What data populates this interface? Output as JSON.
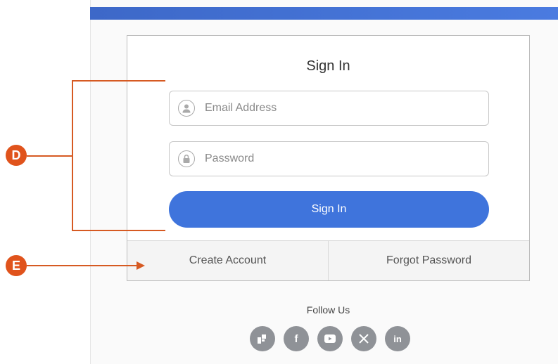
{
  "form": {
    "title": "Sign In",
    "email_placeholder": "Email Address",
    "password_placeholder": "Password",
    "submit_label": "Sign In"
  },
  "footer_links": {
    "create_account": "Create Account",
    "forgot_password": "Forgot Password"
  },
  "follow": {
    "label": "Follow Us",
    "icons": [
      "brand-icon",
      "facebook-icon",
      "youtube-icon",
      "x-icon",
      "linkedin-icon"
    ]
  },
  "annotations": {
    "callout_d": "D",
    "callout_e": "E"
  },
  "colors": {
    "primary": "#3f74dc",
    "callout": "#e0531c",
    "social": "#8f9297"
  }
}
